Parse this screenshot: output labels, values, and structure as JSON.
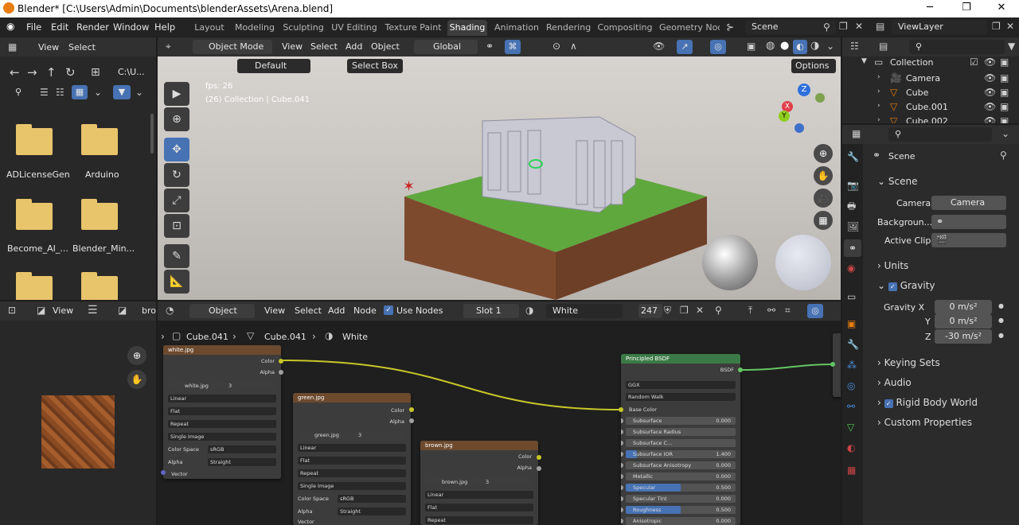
{
  "window": {
    "title": "Blender* [C:\\Users\\Admin\\Documents\\blenderAssets\\Arena.blend]"
  },
  "menu": [
    "File",
    "Edit",
    "Render",
    "Window",
    "Help"
  ],
  "workspaces": [
    "Layout",
    "Modeling",
    "Sculpting",
    "UV Editing",
    "Texture Paint",
    "Shading",
    "Animation",
    "Rendering",
    "Compositing",
    "Geometry Noc"
  ],
  "active_workspace": "Shading",
  "scene_name": "Scene",
  "viewlayer_name": "ViewLayer",
  "file_browser": {
    "view": "View",
    "select": "Select",
    "path": "C:\\U...",
    "folders": [
      "ADLicenseGen",
      "Arduino",
      "Become_AI_...",
      "Blender_Min...",
      "",
      ""
    ]
  },
  "viewport": {
    "mode": "Object Mode",
    "menus": [
      "View",
      "Select",
      "Add",
      "Object"
    ],
    "orientation": "Global",
    "default_label": "Default",
    "select_box": "Select Box",
    "options": "Options",
    "fps": "fps: 26",
    "collection_info": "(26) Collection | Cube.041",
    "gizmo": {
      "z": "Z",
      "x": "X",
      "y": "Y"
    }
  },
  "image_editor": {
    "view": "View",
    "image_name": "bro"
  },
  "node_editor": {
    "type": "Object",
    "menus": [
      "View",
      "Select",
      "Add",
      "Node"
    ],
    "use_nodes": "Use Nodes",
    "slot": "Slot 1",
    "material": "White",
    "users": "247",
    "breadcrumb": [
      "Cube.041",
      "Cube.041",
      "White"
    ],
    "nodes": {
      "white": {
        "title": "white.jpg",
        "image": "white.jpg",
        "users": "3",
        "interp": "Linear",
        "proj": "Flat",
        "ext": "Repeat",
        "src": "Single Image",
        "cs_label": "Color Space",
        "cs": "sRGB",
        "alpha_label": "Alpha",
        "alpha": "Straight",
        "out_color": "Color",
        "out_alpha": "Alpha",
        "in_vector": "Vector"
      },
      "green": {
        "title": "green.jpg",
        "image": "green.jpg",
        "users": "3",
        "interp": "Linear",
        "proj": "Flat",
        "ext": "Repeat",
        "src": "Single Image",
        "cs_label": "Color Space",
        "cs": "sRGB",
        "alpha_label": "Alpha",
        "alpha": "Straight",
        "out_color": "Color",
        "out_alpha": "Alpha",
        "in_vector": "Vector"
      },
      "brown": {
        "title": "brown.jpg",
        "image": "brown.jpg",
        "users": "3",
        "interp": "Linear",
        "proj": "Flat",
        "ext": "Repeat",
        "out_color": "Color",
        "out_alpha": "Alpha"
      },
      "bsdf": {
        "title": "Principled BSDF",
        "out": "BSDF",
        "dist": "GGX",
        "sss_method": "Random Walk",
        "base_color": "Base Color",
        "rows": [
          {
            "label": "Subsurface",
            "value": "0.000",
            "fill": 0
          },
          {
            "label": "Subsurface Radius",
            "value": "",
            "fill": 0
          },
          {
            "label": "Subsurface C...",
            "value": "",
            "fill": 0
          },
          {
            "label": "Subsurface IOR",
            "value": "1.400",
            "fill": 0.1
          },
          {
            "label": "Subsurface Anisotropy",
            "value": "0.000",
            "fill": 0
          },
          {
            "label": "Metallic",
            "value": "0.000",
            "fill": 0
          },
          {
            "label": "Specular",
            "value": "0.500",
            "fill": 0.5
          },
          {
            "label": "Specular Tint",
            "value": "0.000",
            "fill": 0
          },
          {
            "label": "Roughness",
            "value": "0.500",
            "fill": 0.5
          },
          {
            "label": "Anisotropic",
            "value": "0.000",
            "fill": 0
          }
        ]
      }
    }
  },
  "outliner": {
    "collection": "Collection",
    "items": [
      "Camera",
      "Cube",
      "Cube.001",
      "Cube.002"
    ]
  },
  "properties": {
    "header": "Scene",
    "scene_section": "Scene",
    "camera_label": "Camera",
    "camera_value": "Camera",
    "background_label": "Backgroun...",
    "clip_label": "Active Clip",
    "units": "Units",
    "gravity": "Gravity",
    "gravity_x_label": "Gravity X",
    "gravity_x": "0 m/s²",
    "gravity_y_label": "Y",
    "gravity_y": "0 m/s²",
    "gravity_z_label": "Z",
    "gravity_z": "-30 m/s²",
    "sections": [
      "Keying Sets",
      "Audio",
      "Rigid Body World",
      "Custom Properties"
    ]
  }
}
